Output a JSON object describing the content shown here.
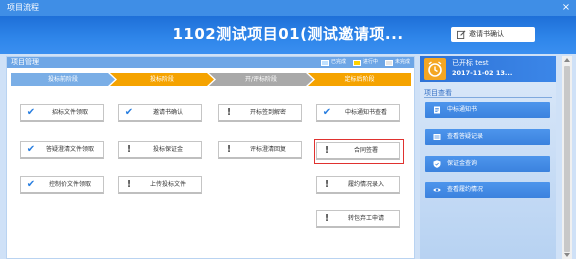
{
  "window": {
    "title": "项目流程",
    "close_glyph": "×"
  },
  "header": {
    "project_title": "1102测试项目01(测试邀请项...",
    "invite_button": "邀请书确认"
  },
  "management": {
    "title": "项目管理",
    "legend": {
      "done": "已完成",
      "doing": "进行中",
      "none": "未完成"
    },
    "stages": [
      "投标前阶段",
      "投标阶段",
      "开/评标阶段",
      "定标后阶段"
    ],
    "steps": {
      "c1": [
        "招标文件领取",
        "答疑澄清文件领取",
        "控制价文件领取"
      ],
      "c2": [
        "邀请书确认",
        "投标保证金",
        "上传投标文件"
      ],
      "c3": [
        "开标签到解密",
        "评标澄清回复"
      ],
      "c4": [
        "中标通知书查看",
        "合同签署",
        "履约情况录入",
        "转包弃工申请"
      ]
    }
  },
  "status": {
    "text": "已开标 test",
    "datetime": "2017-11-02 13..."
  },
  "view": {
    "title": "项目查看",
    "buttons": [
      "中标通知书",
      "查看答疑记录",
      "保证金查询",
      "查看履约情况"
    ]
  },
  "colors": {
    "accent": "#2f86ea",
    "in_progress": "#f5a300",
    "highlight": "#e0322f"
  }
}
